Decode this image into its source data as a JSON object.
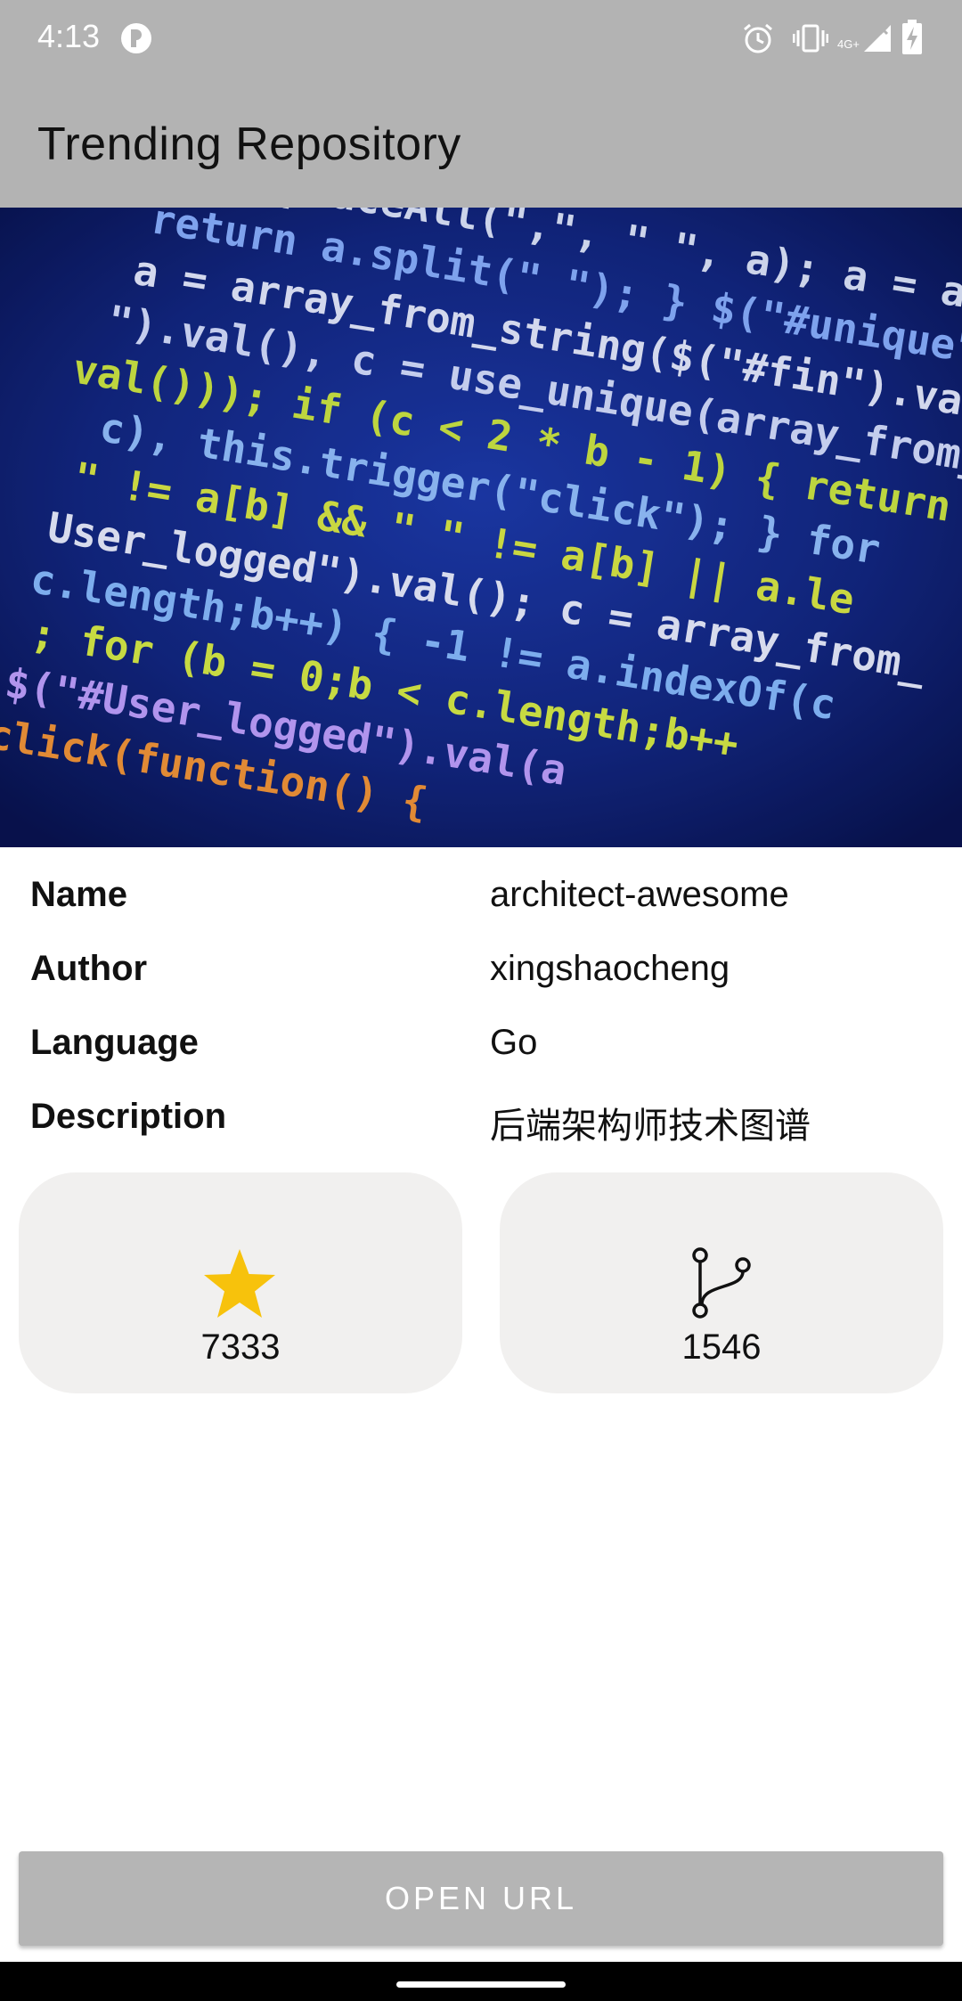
{
  "status_bar": {
    "time": "4:13",
    "network_label": "4G+",
    "icons": [
      "app-notification-icon",
      "alarm-icon",
      "vibrate-icon",
      "signal-icon",
      "battery-charging-icon"
    ]
  },
  "app_bar": {
    "title": "Trending Repository"
  },
  "hero_image": {
    "description_icon": "code-screen-image",
    "code_lines": [
      "= replaceAll(\",\", \" \", a); a = a.replace",
      "return a.split(\" \"); } $(\"#unique\").click",
      "a = array_from_string($(\"#fin\").val",
      "\").val(), c = use_unique(array_from_",
      "val())); if (c < 2 * b - 1) { return",
      "c), this.trigger(\"click\"); } for",
      "\" != a[b] && \" \" != a[b] || a.le",
      "User_logged\").val(); c = array_from_",
      "c.length;b++) { -1 != a.indexOf(c",
      "; for (b = 0;b < c.length;b++",
      "$(\"#User_logged\").val(a",
      "click(function() {"
    ]
  },
  "repo": {
    "rows": [
      {
        "label": "Name",
        "value": "architect-awesome"
      },
      {
        "label": "Author",
        "value": "xingshaocheng"
      },
      {
        "label": "Language",
        "value": "Go"
      },
      {
        "label": "Description",
        "value": "后端架构师技术图谱"
      }
    ],
    "stars": "7333",
    "forks": "1546"
  },
  "colors": {
    "bar": "#b3b3b3",
    "star": "#f7c20c",
    "card": "#f1f0ef",
    "button": "#b5b5b5"
  },
  "actions": {
    "open_url_label": "OPEN URL"
  }
}
